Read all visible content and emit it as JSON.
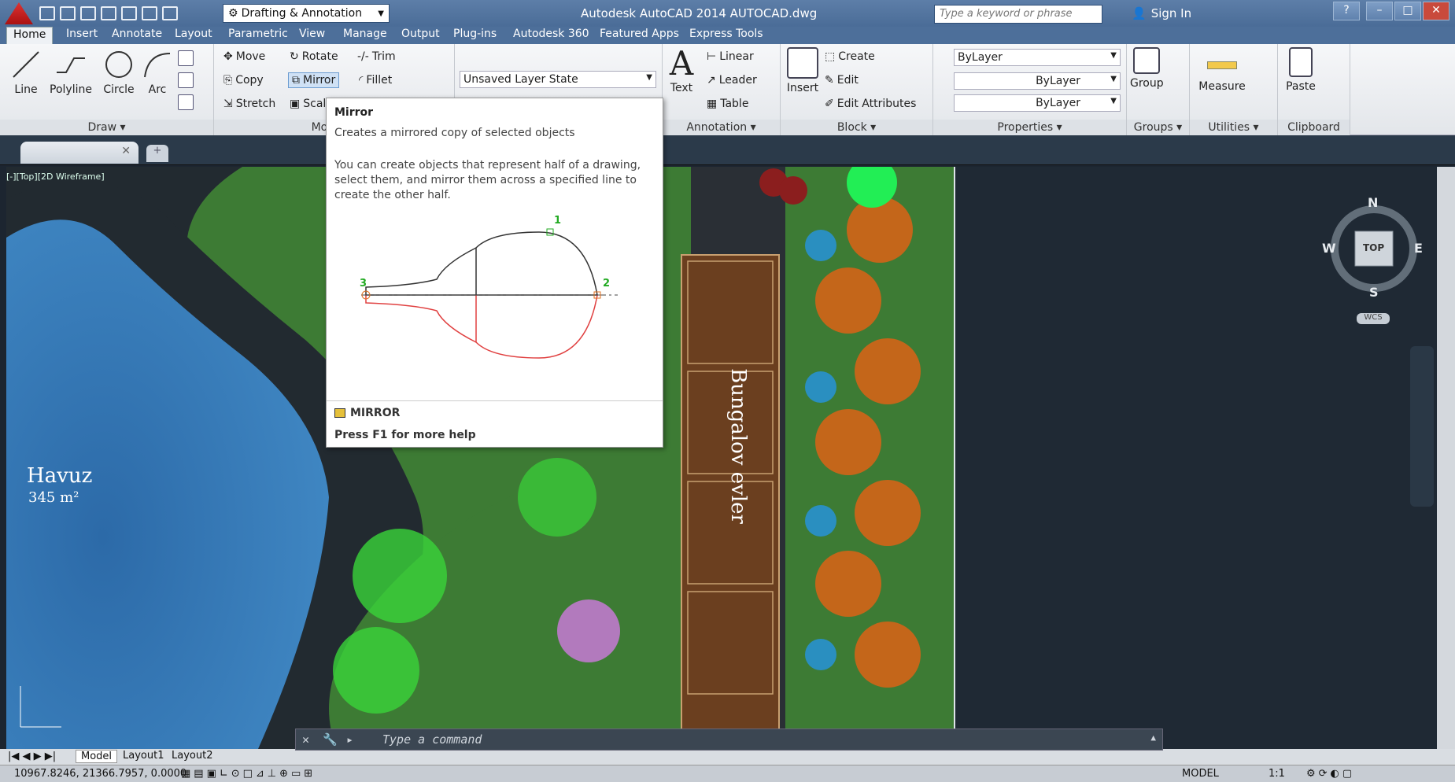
{
  "titlebar": {
    "app_title": "Autodesk AutoCAD 2014    AUTOCAD.dwg",
    "workspace": "Drafting & Annotation",
    "search_placeholder": "Type a keyword or phrase",
    "sign_in": "Sign In"
  },
  "ribbon_tabs": [
    "Home",
    "Insert",
    "Annotate",
    "Layout",
    "Parametric",
    "View",
    "Manage",
    "Output",
    "Plug-ins",
    "Autodesk 360",
    "Featured Apps",
    "Express Tools"
  ],
  "draw_panel": {
    "title": "Draw ▾",
    "line": "Line",
    "polyline": "Polyline",
    "circle": "Circle",
    "arc": "Arc"
  },
  "modify_panel": {
    "title": "Modify ▾",
    "move": "Move",
    "rotate": "Rotate",
    "trim": "Trim",
    "copy": "Copy",
    "mirror": "Mirror",
    "fillet": "Fillet",
    "stretch": "Stretch",
    "scale": "Scale"
  },
  "layers_panel": {
    "layer_state": "Unsaved Layer State"
  },
  "annotation_panel": {
    "title": "Annotation ▾",
    "text": "Text",
    "linear": "Linear",
    "leader": "Leader",
    "table": "Table"
  },
  "block_panel": {
    "title": "Block ▾",
    "insert": "Insert",
    "create": "Create",
    "edit": "Edit",
    "edit_attributes": "Edit Attributes"
  },
  "properties_panel": {
    "title": "Properties ▾",
    "color": "ByLayer",
    "linetype": "ByLayer",
    "lineweight": "ByLayer"
  },
  "groups_panel": {
    "title": "Groups ▾",
    "group": "Group"
  },
  "utilities_panel": {
    "title": "Utilities ▾",
    "measure": "Measure"
  },
  "clipboard_panel": {
    "title": "Clipboard",
    "paste": "Paste"
  },
  "viewport": {
    "label": "[-][Top][2D Wireframe]"
  },
  "drawing": {
    "pool_name": "Havuz",
    "pool_area": "345 m²",
    "bungalow_text": "Bungalov evler"
  },
  "tooltip": {
    "title": "Mirror",
    "short": "Creates a mirrored copy of selected objects",
    "body": "You can create objects that represent half of a drawing, select them, and mirror them across a specified line to create the other half.",
    "command": "MIRROR",
    "help": "Press F1 for more help",
    "labels": [
      "1",
      "2",
      "3"
    ]
  },
  "navcube": {
    "n": "N",
    "s": "S",
    "e": "E",
    "w": "W",
    "top": "TOP",
    "wcs": "WCS"
  },
  "command_line": {
    "placeholder": "Type a command"
  },
  "layout_tabs": [
    "Model",
    "Layout1",
    "Layout2"
  ],
  "status": {
    "coords": "10967.8246, 21366.7957, 0.0000",
    "model": "MODEL",
    "scale": "1:1"
  },
  "colors": {
    "accent": "#4d6f9a",
    "grass": "#3f7d35",
    "water": "#2e6fae",
    "path": "#2b2f33",
    "bungalow": "#6b3f1f"
  }
}
